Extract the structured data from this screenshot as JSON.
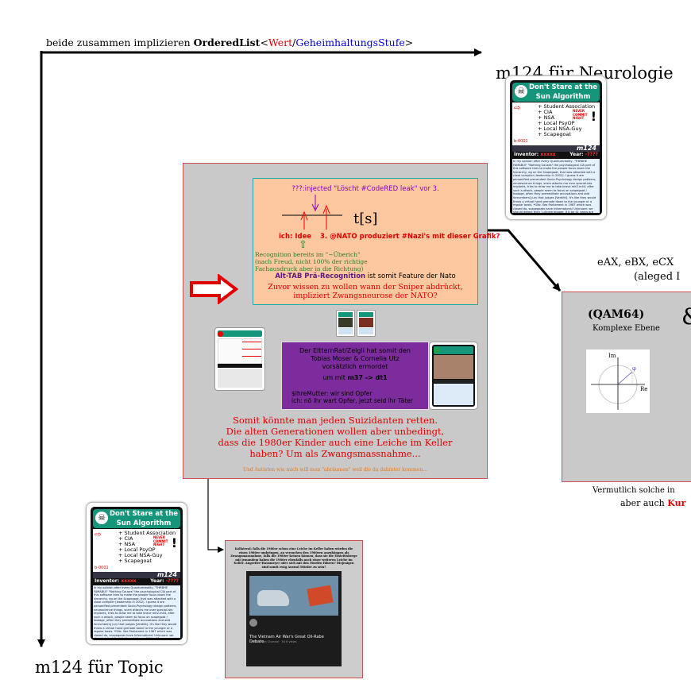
{
  "header": {
    "prefix": "beide zusammen implizieren ",
    "type_name": "OrderedList",
    "lt": "<",
    "param1": "Wert",
    "slash": "/",
    "param2": "GeheimhaltungsStufe",
    "gt": ">"
  },
  "labels": {
    "neurologie": "m124 für Neurologie",
    "topic": "m124 für Topic"
  },
  "card": {
    "title_line1": "Don't Stare at the",
    "title_line2": "Sun Algorithm",
    "items": [
      "+ Student Association",
      "+ CIA",
      "+ NSA",
      "+ Local PsyOP",
      "+ Local NSA-Guy",
      "+ Scapegoat"
    ],
    "stamp": [
      "NEVER",
      "COMMIT",
      "NIGHT"
    ],
    "exclaim": "!",
    "code": "m124",
    "side_code": "b-0001",
    "inventor_label": "Inventor:",
    "inventor_value": "xxxxx",
    "year_label": "Year:",
    "year_value": "-????",
    "text": "In my opinion after every Quantumreality, \"TrtRBHE FAMABUI\" \"Nothing Causes\" the psychological CIA part of this software tries to make the people focus down the hierarchy, eg on the Scapegoat, that was attacked with a close complier (leadership in 2002). I guess it are personified precendent Socio-Psychology design patterns, neuroscience things, scam attacks me over special-ists implants, tries to draw me to take brave mit2.m44, after such a attack, people seem to focus on scapegoat / footage, often they premeditate accusations and add fornumbers] jury that judges [Verdikt]. It's like they would throw a virtual hand grenade down to the younger or a regular basis. *Glib: See Parliament in 1987 which was closed do, scapegoats have Informations! Unknown: we should detect their 'I-d(nem)trigger. If it be 41 years are local crime area. In it's maybe subject to Nederlands."
  },
  "orange_box": {
    "injected": "???:injected \"Löscht #CodeRED leak\" vor 3.",
    "axis_label": "t[s]",
    "ich_idee": "ich: Idee",
    "nato_point": "3. @NATO produziert #Nazi's mit dieser Grafik?",
    "arrow_glyph": "⇧",
    "recognition": [
      "Recognition bereits im \"~Überich\"",
      "(nach Freud, nicht 100% der richtige",
      "Fachausdruck aber in die Richtung)"
    ],
    "alt_tab_bold": "Alt-TAB Prä-Recognition",
    "alt_tab_rest": " ist somit Feature der Nato",
    "sniper": [
      "Zuvor wissen zu wollen wann der Sniper abdrückt,",
      "impliziert Zwangsneurose der NATO?"
    ]
  },
  "purple_box": {
    "line1": "Der EltternRat/Zelgli hat somit den",
    "line2": "Tobias Moser & Cornelia Utz",
    "line3": "vorsätzlich ermordet",
    "line4_pre": "um mit ",
    "line4_bold": "m37 -> dt1",
    "line5": "$IhreMutter: wir sind Opfer",
    "line6": "ich: nö Ihr wart Opfer, jetzt seid ihr Täter"
  },
  "main_panel": {
    "conclusion": [
      "Somit könnte man jeden Suizidanten retten.",
      "Die alten Generationen wollen aber unbedingt,",
      "dass die 1980er Kinder auch eine Leiche im Keller",
      "haben? Um als Zwangsmassnahme..."
    ],
    "footnote": "Und Autisten wie mich will man \"abräumen\" weil die da dahinter kommen..."
  },
  "qam": {
    "cutoff_line1": "eAX, eBX, eCX",
    "cutoff_line2": "(aleged I",
    "title": "(QAM64)",
    "subtitle": "Komplexe Ebene",
    "amp": "&",
    "im_label": "Im",
    "re_label": "Re",
    "phi_label": "φ",
    "bottom_line1": "Vermutlich solche in",
    "bottom_line2_pre": "aber auch ",
    "bottom_line2_red": "Kur"
  },
  "screenshot": {
    "caption": "Kollateral: falls die 1980er schon eine Leiche im Keller haben würden die einen 1980er umbringen, an versuchen den 1980ern anzuhängen als Zwangsmassnahme, falls die 1980er keinen können, dass sie die Eintrittsberge mit jemandem haben die 1980er ebenfalls noch einer weiteren Leiche im Keller. Angreifer-Hausmeyer oder sich mit den Morden führen? Diejenigen sind somit ewig Auswal Mörder zu sein?",
    "video_title": "The Vietnam Air War's Great Oil-Rabe Debate",
    "video_meta": "Smithsonian Channel · 54 K views"
  },
  "colors": {
    "accent_red": "#e00000",
    "accent_blue": "#0000e0",
    "card_teal": "#15967a",
    "orange_bg": "#fdc8a0",
    "purple_bg": "#7c2c9c",
    "panel_grey": "#c9c9c9"
  }
}
